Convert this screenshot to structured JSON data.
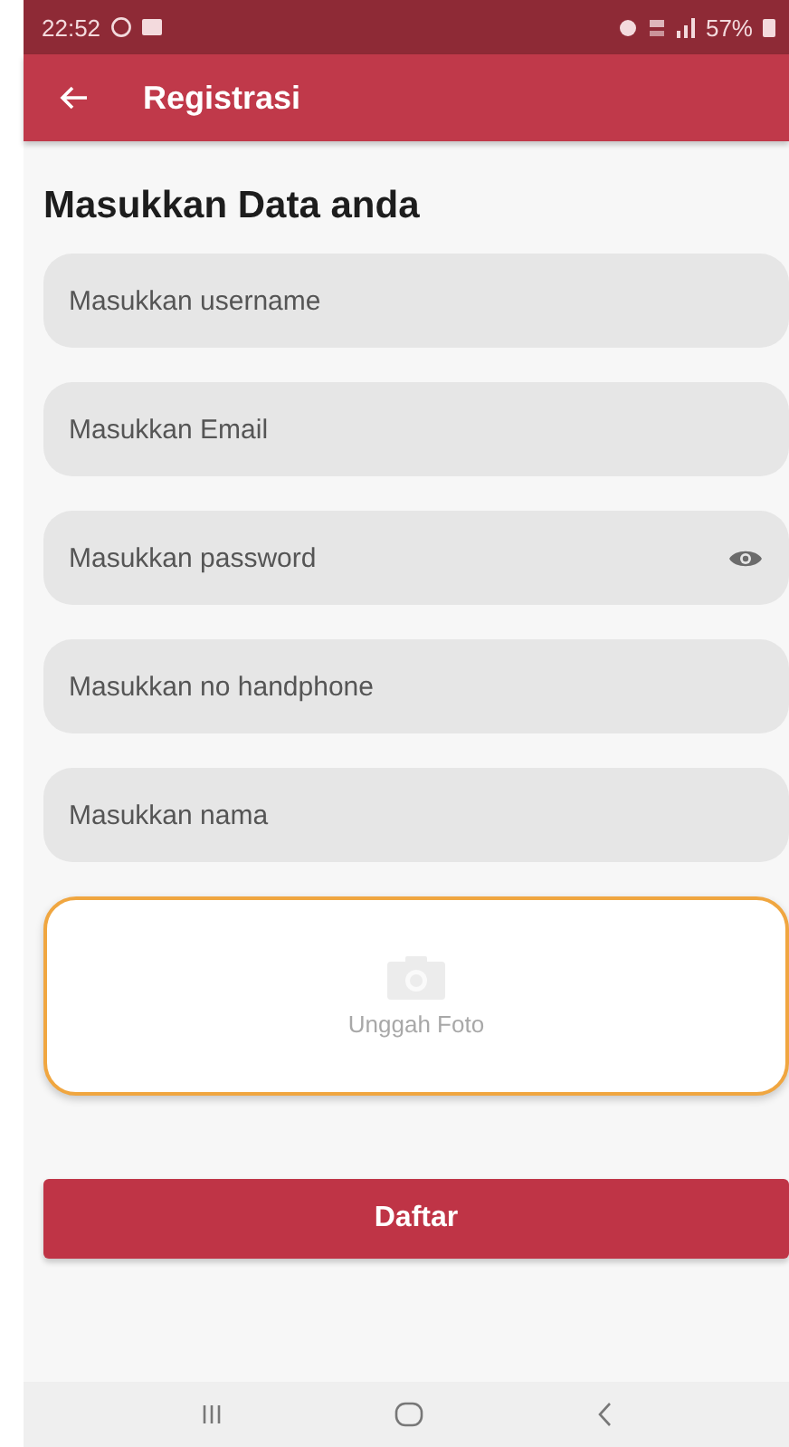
{
  "status_bar": {
    "time": "22:52",
    "battery": "57%"
  },
  "app_bar": {
    "title": "Registrasi"
  },
  "heading": "Masukkan Data anda",
  "fields": [
    {
      "placeholder": "Masukkan username",
      "kind": "text"
    },
    {
      "placeholder": "Masukkan Email",
      "kind": "text"
    },
    {
      "placeholder": "Masukkan password",
      "kind": "password"
    },
    {
      "placeholder": "Masukkan no handphone",
      "kind": "text"
    },
    {
      "placeholder": "Masukkan nama",
      "kind": "text"
    }
  ],
  "photo_upload": {
    "label": "Unggah Foto"
  },
  "submit_button": "Daftar"
}
